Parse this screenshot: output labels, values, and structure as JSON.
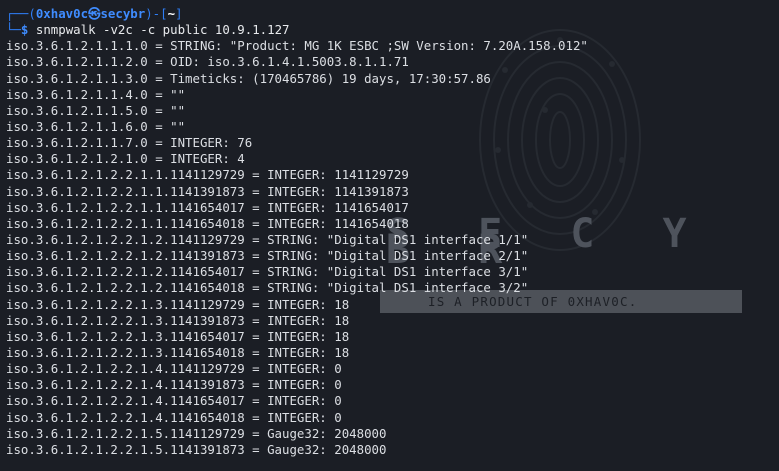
{
  "prompt": {
    "corner_top": "┌──(",
    "user": "0xhav0c",
    "at_symbol": "㉿",
    "host": "secybr",
    "close_paren": ")-[",
    "dir": "~",
    "close_bracket": "]",
    "corner_bottom": "└─",
    "dollar": "$",
    "command": "snmpwalk -v2c -c public 10.9.1.127"
  },
  "watermark": {
    "brand": "S E C Y B R",
    "tagline": "IS A PRODUCT OF 0XHAV0C."
  },
  "output_lines": [
    "iso.3.6.1.2.1.1.1.0 = STRING: \"Product: MG 1K ESBC ;SW Version: 7.20A.158.012\"",
    "iso.3.6.1.2.1.1.2.0 = OID: iso.3.6.1.4.1.5003.8.1.1.71",
    "iso.3.6.1.2.1.1.3.0 = Timeticks: (170465786) 19 days, 17:30:57.86",
    "iso.3.6.1.2.1.1.4.0 = \"\"",
    "iso.3.6.1.2.1.1.5.0 = \"\"",
    "iso.3.6.1.2.1.1.6.0 = \"\"",
    "iso.3.6.1.2.1.1.7.0 = INTEGER: 76",
    "iso.3.6.1.2.1.2.1.0 = INTEGER: 4",
    "iso.3.6.1.2.1.2.2.1.1.1141129729 = INTEGER: 1141129729",
    "iso.3.6.1.2.1.2.2.1.1.1141391873 = INTEGER: 1141391873",
    "iso.3.6.1.2.1.2.2.1.1.1141654017 = INTEGER: 1141654017",
    "iso.3.6.1.2.1.2.2.1.1.1141654018 = INTEGER: 1141654018",
    "iso.3.6.1.2.1.2.2.1.2.1141129729 = STRING: \"Digital DS1 interface 1/1\"",
    "iso.3.6.1.2.1.2.2.1.2.1141391873 = STRING: \"Digital DS1 interface 2/1\"",
    "iso.3.6.1.2.1.2.2.1.2.1141654017 = STRING: \"Digital DS1 interface 3/1\"",
    "iso.3.6.1.2.1.2.2.1.2.1141654018 = STRING: \"Digital DS1 interface 3/2\"",
    "iso.3.6.1.2.1.2.2.1.3.1141129729 = INTEGER: 18",
    "iso.3.6.1.2.1.2.2.1.3.1141391873 = INTEGER: 18",
    "iso.3.6.1.2.1.2.2.1.3.1141654017 = INTEGER: 18",
    "iso.3.6.1.2.1.2.2.1.3.1141654018 = INTEGER: 18",
    "iso.3.6.1.2.1.2.2.1.4.1141129729 = INTEGER: 0",
    "iso.3.6.1.2.1.2.2.1.4.1141391873 = INTEGER: 0",
    "iso.3.6.1.2.1.2.2.1.4.1141654017 = INTEGER: 0",
    "iso.3.6.1.2.1.2.2.1.4.1141654018 = INTEGER: 0",
    "iso.3.6.1.2.1.2.2.1.5.1141129729 = Gauge32: 2048000",
    "iso.3.6.1.2.1.2.2.1.5.1141391873 = Gauge32: 2048000"
  ]
}
